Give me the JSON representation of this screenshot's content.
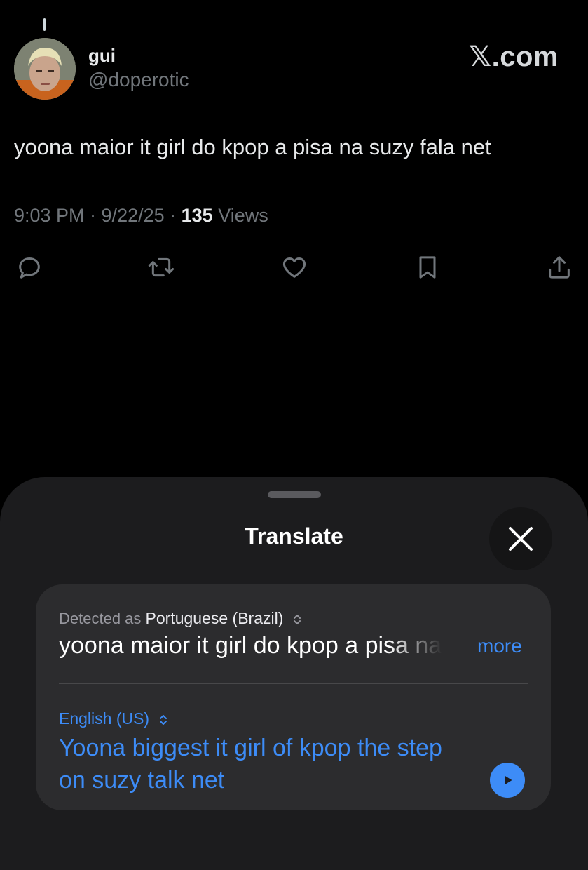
{
  "tweet": {
    "display_name": "gui",
    "handle": "@doperotic",
    "brand": "𝕏.com",
    "text": "yoona maior it girl do kpop a pisa na suzy fala net",
    "time": "9:03 PM · 9/22/25 · ",
    "views_count": "135",
    "views_label": " Views",
    "actions": [
      {
        "name": "reply",
        "icon": "speech-bubble-icon"
      },
      {
        "name": "repost",
        "icon": "repost-arrows-icon"
      },
      {
        "name": "like",
        "icon": "heart-icon"
      },
      {
        "name": "bookmark",
        "icon": "bookmark-icon"
      },
      {
        "name": "share",
        "icon": "share-upload-icon"
      }
    ]
  },
  "translate_sheet": {
    "title": "Translate",
    "source": {
      "detected_prefix": "Detected as ",
      "language": "Portuguese (Brazil)",
      "text": "yoona maior it girl do kpop a pisa na suzy fala net",
      "more_label": "more"
    },
    "target": {
      "language": "English (US)",
      "text": "Yoona biggest it girl of kpop the step on suzy talk net"
    }
  },
  "colors": {
    "background": "#000000",
    "sheet": "#1c1c1e",
    "card": "#2c2c2e",
    "accent": "#3d8cf7",
    "secondary_text": "#71767b"
  }
}
